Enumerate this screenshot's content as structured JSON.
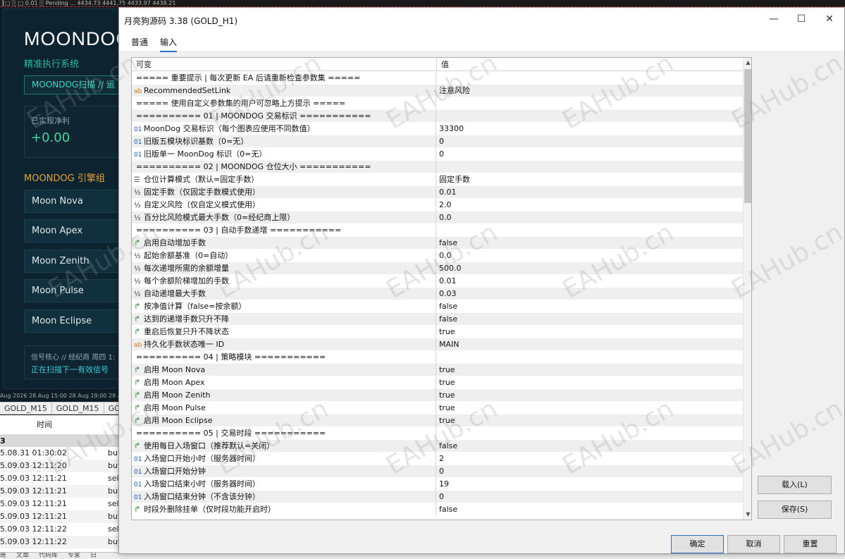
{
  "background": {
    "topbar_text": "┃□ ░ □ 0.01 ░ Pending ...   4434.73 4441.75 4433.97 4438.21",
    "title": "MOONDOG",
    "subtitle": "精准执行系统",
    "scan_label": "MOONDOG扫描 // 运",
    "pnl_label": "已实现净利",
    "pnl_value": "+0.00",
    "engines_title": "MOONDOG 引擎组",
    "engines": [
      "Moon Nova",
      "Moon Apex",
      "Moon Zenith",
      "Moon Pulse",
      "Moon Eclipse"
    ],
    "signal_line1": "信号核心 // 经纪商 周四 1:",
    "signal_line2": "正在扫描下一有效信号",
    "chart_dates": "Aug 2026   28 Aug 15:00   28 Aug 19:00   28 Au",
    "symbol_tabs": [
      "GOLD_M15",
      "GOLD_M15",
      "GO"
    ],
    "orders_header": "时间",
    "orders_group": "3",
    "orders": [
      {
        "time": "5.08.31 01:30:02",
        "type": "buy"
      },
      {
        "time": "5.09.03 12:11:20",
        "type": "buy"
      },
      {
        "time": "5.09.03 12:11:21",
        "type": "sell"
      },
      {
        "time": "5.09.03 12:11:21",
        "type": "buy"
      },
      {
        "time": "5.09.03 12:11:21",
        "type": "sell"
      },
      {
        "time": "5.09.03 12:11:21",
        "type": "buy"
      },
      {
        "time": "5.09.03 12:11:22",
        "type": "sell"
      },
      {
        "time": "5.09.03 12:11:22",
        "type": "buy"
      }
    ],
    "bottom_tabs": [
      "账",
      "文章",
      "代码库",
      "专家",
      "日"
    ]
  },
  "dialog": {
    "title": "月亮狗源码 3.38 (GOLD_H1)",
    "tabs": [
      "普通",
      "输入"
    ],
    "active_tab": "输入",
    "columns": {
      "name": "可变",
      "value": "值"
    },
    "params": [
      {
        "icon": "",
        "name": "===== 重要提示 | 每次更新 EA 后请重新检查参数集 =====",
        "value": ""
      },
      {
        "icon": "ab",
        "name": "RecommendedSetLink",
        "value": "注意风险"
      },
      {
        "icon": "",
        "name": "===== 使用自定义参数集的用户可忽略上方提示 =====",
        "value": ""
      },
      {
        "icon": "",
        "name": "========== 01 | MOONDOG 交易标识 ===========",
        "value": ""
      },
      {
        "icon": "01",
        "name": "MoonDog 交易标识（每个图表应使用不同数值）",
        "value": "33300"
      },
      {
        "icon": "01",
        "name": "旧版五模块标识基数（0=无）",
        "value": "0"
      },
      {
        "icon": "01",
        "name": "旧版单一 MoonDog 标识（0=无）",
        "value": "0"
      },
      {
        "icon": "",
        "name": "========== 02 | MOONDOG 仓位大小 ===========",
        "value": ""
      },
      {
        "icon": "enum",
        "name": "仓位计算模式（默认=固定手数）",
        "value": "固定手数"
      },
      {
        "icon": "½",
        "name": "固定手数（仅固定手数模式使用）",
        "value": "0.01"
      },
      {
        "icon": "½",
        "name": "自定义风险（仅自定义模式使用）",
        "value": "2.0"
      },
      {
        "icon": "½",
        "name": "百分比风险模式最大手数（0=经纪商上限）",
        "value": "0.0"
      },
      {
        "icon": "",
        "name": "========== 03 | 自动手数递增 ===========",
        "value": ""
      },
      {
        "icon": "bool",
        "name": "启用自动增加手数",
        "value": "false"
      },
      {
        "icon": "½",
        "name": "起始余额基准（0=自动）",
        "value": "0.0"
      },
      {
        "icon": "½",
        "name": "每次递增所需的余额增量",
        "value": "500.0"
      },
      {
        "icon": "½",
        "name": "每个余额阶梯增加的手数",
        "value": "0.01"
      },
      {
        "icon": "½",
        "name": "自动递增最大手数",
        "value": "0.03"
      },
      {
        "icon": "bool",
        "name": "按净值计算（false=按余额）",
        "value": "false"
      },
      {
        "icon": "bool",
        "name": "达到的递增手数只升不降",
        "value": "false"
      },
      {
        "icon": "bool",
        "name": "重启后恢复只升不降状态",
        "value": "true"
      },
      {
        "icon": "ab",
        "name": "持久化手数状态唯一 ID",
        "value": "MAIN"
      },
      {
        "icon": "",
        "name": "========== 04 | 策略模块 ===========",
        "value": ""
      },
      {
        "icon": "bool",
        "name": "启用 Moon Nova",
        "value": "true"
      },
      {
        "icon": "bool",
        "name": "启用 Moon Apex",
        "value": "true"
      },
      {
        "icon": "bool",
        "name": "启用 Moon Zenith",
        "value": "true"
      },
      {
        "icon": "bool",
        "name": "启用 Moon Pulse",
        "value": "true"
      },
      {
        "icon": "bool",
        "name": "启用 Moon Eclipse",
        "value": "true"
      },
      {
        "icon": "",
        "name": "========== 05 | 交易时段 ===========",
        "value": ""
      },
      {
        "icon": "bool",
        "name": "使用每日入场窗口（推荐默认=关闭）",
        "value": "false"
      },
      {
        "icon": "01",
        "name": "入场窗口开始小时（服务器时间）",
        "value": "2"
      },
      {
        "icon": "01",
        "name": "入场窗口开始分钟",
        "value": "0"
      },
      {
        "icon": "01",
        "name": "入场窗口结束小时（服务器时间）",
        "value": "19"
      },
      {
        "icon": "01",
        "name": "入场窗口结束分钟（不含该分钟）",
        "value": "0"
      },
      {
        "icon": "bool",
        "name": "时段外删除挂单（仅时段功能开启时）",
        "value": "false"
      }
    ],
    "buttons": {
      "load": "载入(L)",
      "save": "保存(S)",
      "ok": "确定",
      "cancel": "取消",
      "reset": "重置"
    },
    "window_controls": {
      "minimize": "—",
      "maximize": "☐",
      "close": "✕"
    }
  },
  "watermark": "EAHub.cn",
  "colors": {
    "accent": "#2b72c2",
    "bool_icon": "#2e8b2e",
    "int_icon": "#1a55b5",
    "bg_dark": "#0e1c25"
  }
}
